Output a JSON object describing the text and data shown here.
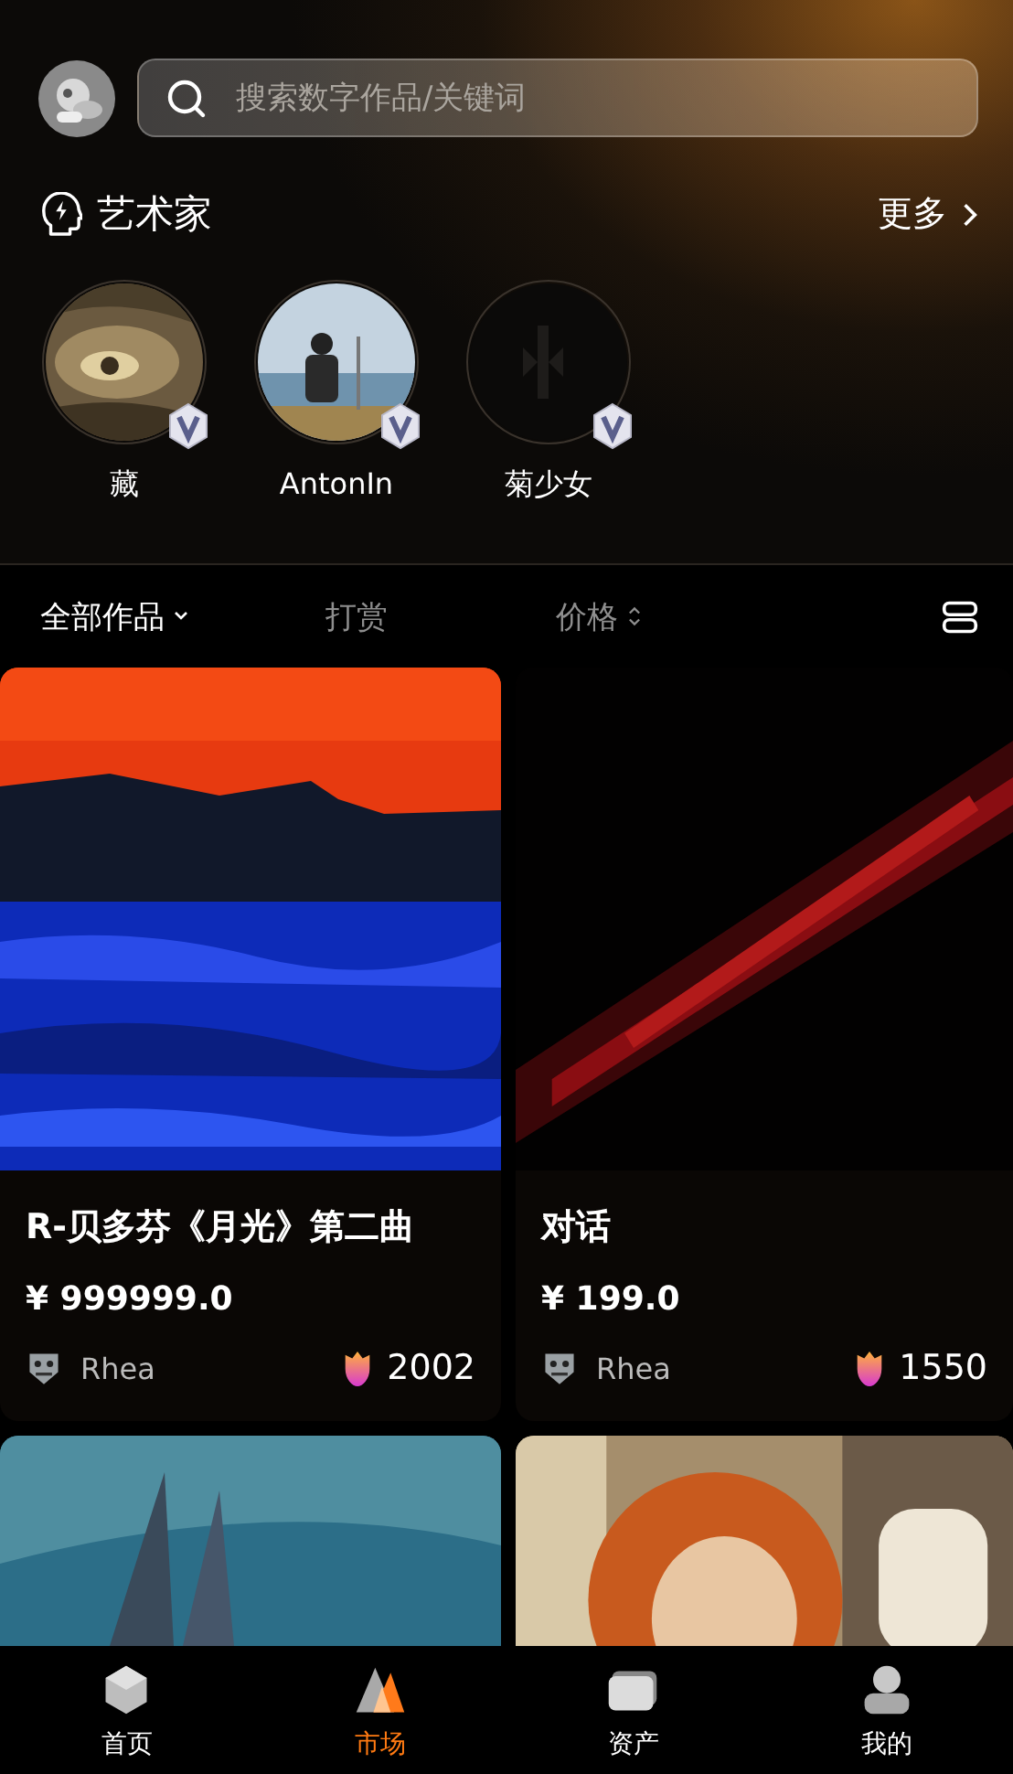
{
  "search": {
    "placeholder": "搜索数字作品/关键词"
  },
  "artists_section": {
    "title": "艺术家",
    "more": "更多"
  },
  "artists": [
    {
      "name": "藏",
      "verified": true
    },
    {
      "name": "AntonIn",
      "verified": true
    },
    {
      "name": "菊少女",
      "verified": true
    }
  ],
  "filters": [
    {
      "label": "全部作品",
      "selected": true,
      "kind": "dropdown"
    },
    {
      "label": "打赏",
      "selected": false,
      "kind": "plain"
    },
    {
      "label": "价格",
      "selected": false,
      "kind": "sort"
    }
  ],
  "works": [
    {
      "title": "R-贝多芬《月光》第二曲",
      "price": "¥ 999999.0",
      "owner": "Rhea",
      "likes": "2002",
      "kind": "sea"
    },
    {
      "title": "对话",
      "price": "¥ 199.0",
      "owner": "Rhea",
      "likes": "1550",
      "kind": "speckle"
    },
    {
      "kind": "ship"
    },
    {
      "kind": "portrait"
    }
  ],
  "nav": [
    {
      "label": "首页",
      "selected": false,
      "kind": "home"
    },
    {
      "label": "市场",
      "selected": true,
      "kind": "market"
    },
    {
      "label": "资产",
      "selected": false,
      "kind": "assets"
    },
    {
      "label": "我的",
      "selected": false,
      "kind": "me"
    }
  ]
}
